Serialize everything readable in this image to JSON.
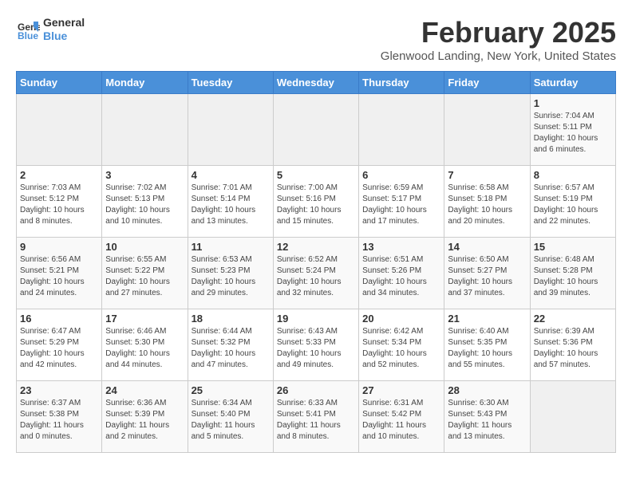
{
  "header": {
    "logo_line1": "General",
    "logo_line2": "Blue",
    "month": "February 2025",
    "location": "Glenwood Landing, New York, United States"
  },
  "weekdays": [
    "Sunday",
    "Monday",
    "Tuesday",
    "Wednesday",
    "Thursday",
    "Friday",
    "Saturday"
  ],
  "rows": [
    [
      {
        "day": "",
        "detail": ""
      },
      {
        "day": "",
        "detail": ""
      },
      {
        "day": "",
        "detail": ""
      },
      {
        "day": "",
        "detail": ""
      },
      {
        "day": "",
        "detail": ""
      },
      {
        "day": "",
        "detail": ""
      },
      {
        "day": "1",
        "detail": "Sunrise: 7:04 AM\nSunset: 5:11 PM\nDaylight: 10 hours\nand 6 minutes."
      }
    ],
    [
      {
        "day": "2",
        "detail": "Sunrise: 7:03 AM\nSunset: 5:12 PM\nDaylight: 10 hours\nand 8 minutes."
      },
      {
        "day": "3",
        "detail": "Sunrise: 7:02 AM\nSunset: 5:13 PM\nDaylight: 10 hours\nand 10 minutes."
      },
      {
        "day": "4",
        "detail": "Sunrise: 7:01 AM\nSunset: 5:14 PM\nDaylight: 10 hours\nand 13 minutes."
      },
      {
        "day": "5",
        "detail": "Sunrise: 7:00 AM\nSunset: 5:16 PM\nDaylight: 10 hours\nand 15 minutes."
      },
      {
        "day": "6",
        "detail": "Sunrise: 6:59 AM\nSunset: 5:17 PM\nDaylight: 10 hours\nand 17 minutes."
      },
      {
        "day": "7",
        "detail": "Sunrise: 6:58 AM\nSunset: 5:18 PM\nDaylight: 10 hours\nand 20 minutes."
      },
      {
        "day": "8",
        "detail": "Sunrise: 6:57 AM\nSunset: 5:19 PM\nDaylight: 10 hours\nand 22 minutes."
      }
    ],
    [
      {
        "day": "9",
        "detail": "Sunrise: 6:56 AM\nSunset: 5:21 PM\nDaylight: 10 hours\nand 24 minutes."
      },
      {
        "day": "10",
        "detail": "Sunrise: 6:55 AM\nSunset: 5:22 PM\nDaylight: 10 hours\nand 27 minutes."
      },
      {
        "day": "11",
        "detail": "Sunrise: 6:53 AM\nSunset: 5:23 PM\nDaylight: 10 hours\nand 29 minutes."
      },
      {
        "day": "12",
        "detail": "Sunrise: 6:52 AM\nSunset: 5:24 PM\nDaylight: 10 hours\nand 32 minutes."
      },
      {
        "day": "13",
        "detail": "Sunrise: 6:51 AM\nSunset: 5:26 PM\nDaylight: 10 hours\nand 34 minutes."
      },
      {
        "day": "14",
        "detail": "Sunrise: 6:50 AM\nSunset: 5:27 PM\nDaylight: 10 hours\nand 37 minutes."
      },
      {
        "day": "15",
        "detail": "Sunrise: 6:48 AM\nSunset: 5:28 PM\nDaylight: 10 hours\nand 39 minutes."
      }
    ],
    [
      {
        "day": "16",
        "detail": "Sunrise: 6:47 AM\nSunset: 5:29 PM\nDaylight: 10 hours\nand 42 minutes."
      },
      {
        "day": "17",
        "detail": "Sunrise: 6:46 AM\nSunset: 5:30 PM\nDaylight: 10 hours\nand 44 minutes."
      },
      {
        "day": "18",
        "detail": "Sunrise: 6:44 AM\nSunset: 5:32 PM\nDaylight: 10 hours\nand 47 minutes."
      },
      {
        "day": "19",
        "detail": "Sunrise: 6:43 AM\nSunset: 5:33 PM\nDaylight: 10 hours\nand 49 minutes."
      },
      {
        "day": "20",
        "detail": "Sunrise: 6:42 AM\nSunset: 5:34 PM\nDaylight: 10 hours\nand 52 minutes."
      },
      {
        "day": "21",
        "detail": "Sunrise: 6:40 AM\nSunset: 5:35 PM\nDaylight: 10 hours\nand 55 minutes."
      },
      {
        "day": "22",
        "detail": "Sunrise: 6:39 AM\nSunset: 5:36 PM\nDaylight: 10 hours\nand 57 minutes."
      }
    ],
    [
      {
        "day": "23",
        "detail": "Sunrise: 6:37 AM\nSunset: 5:38 PM\nDaylight: 11 hours\nand 0 minutes."
      },
      {
        "day": "24",
        "detail": "Sunrise: 6:36 AM\nSunset: 5:39 PM\nDaylight: 11 hours\nand 2 minutes."
      },
      {
        "day": "25",
        "detail": "Sunrise: 6:34 AM\nSunset: 5:40 PM\nDaylight: 11 hours\nand 5 minutes."
      },
      {
        "day": "26",
        "detail": "Sunrise: 6:33 AM\nSunset: 5:41 PM\nDaylight: 11 hours\nand 8 minutes."
      },
      {
        "day": "27",
        "detail": "Sunrise: 6:31 AM\nSunset: 5:42 PM\nDaylight: 11 hours\nand 10 minutes."
      },
      {
        "day": "28",
        "detail": "Sunrise: 6:30 AM\nSunset: 5:43 PM\nDaylight: 11 hours\nand 13 minutes."
      },
      {
        "day": "",
        "detail": ""
      }
    ]
  ]
}
